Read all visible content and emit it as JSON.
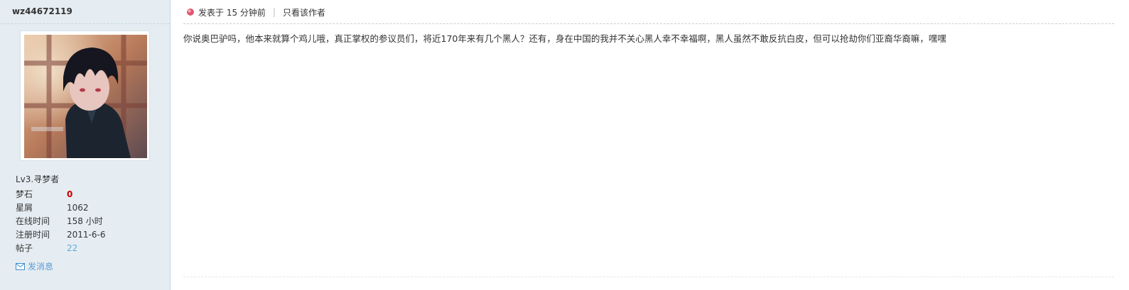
{
  "user": {
    "username": "wz44672119",
    "group": "Lv3.寻梦者",
    "stats": [
      {
        "label": "梦石",
        "value": "0",
        "style": "red"
      },
      {
        "label": "星屑",
        "value": "1062",
        "style": "normal"
      },
      {
        "label": "在线时间",
        "value": "158 小时",
        "style": "normal"
      },
      {
        "label": "注册时间",
        "value": "2011-6-6",
        "style": "normal"
      },
      {
        "label": "帖子",
        "value": "22",
        "style": "link"
      }
    ],
    "send_message_label": "发消息"
  },
  "post": {
    "posted_text": "发表于 15 分钟前",
    "separator": "|",
    "author_only_label": "只看该作者",
    "content": "你说奥巴驴吗，他本来就算个鸡儿哦，真正掌权的参议员们，将近170年来有几个黑人？还有，身在中国的我并不关心黑人幸不幸福啊，黑人虽然不敢反抗白皮，但可以抢劫你们亚裔华裔嘛，嘿嘿"
  },
  "colors": {
    "sidebar_bg": "#e5edf2",
    "accent_link": "#62a6d6",
    "stat_highlight": "#cc0000"
  },
  "icons": {
    "post_status": "post-status-icon",
    "mail": "mail-icon"
  }
}
